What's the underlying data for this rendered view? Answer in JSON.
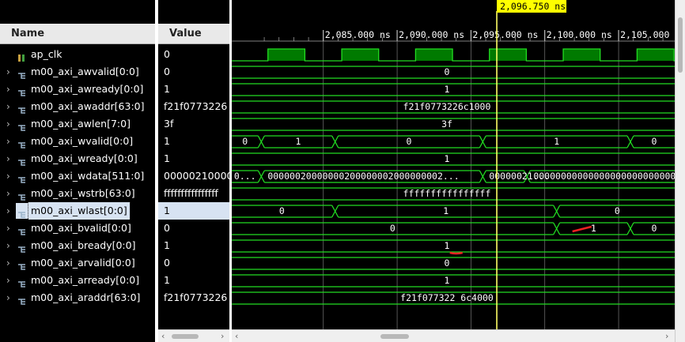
{
  "headers": {
    "name": "Name",
    "value": "Value"
  },
  "signals": [
    {
      "name": "ap_clk",
      "value": "0",
      "expandable": false,
      "icon": "clock-signal-icon"
    },
    {
      "name": "m00_axi_awvalid[0:0]",
      "value": "0",
      "expandable": true
    },
    {
      "name": "m00_axi_awready[0:0]",
      "value": "1",
      "expandable": true
    },
    {
      "name": "m00_axi_awaddr[63:0]",
      "value": "f21f0773226",
      "expandable": true
    },
    {
      "name": "m00_axi_awlen[7:0]",
      "value": "3f",
      "expandable": true
    },
    {
      "name": "m00_axi_wvalid[0:0]",
      "value": "1",
      "expandable": true
    },
    {
      "name": "m00_axi_wready[0:0]",
      "value": "1",
      "expandable": true
    },
    {
      "name": "m00_axi_wdata[511:0]",
      "value": "00000210000",
      "expandable": true
    },
    {
      "name": "m00_axi_wstrb[63:0]",
      "value": "ffffffffffffffff",
      "expandable": true
    },
    {
      "name": "m00_axi_wlast[0:0]",
      "value": "1",
      "expandable": true,
      "selected": true
    },
    {
      "name": "m00_axi_bvalid[0:0]",
      "value": "0",
      "expandable": true
    },
    {
      "name": "m00_axi_bready[0:0]",
      "value": "1",
      "expandable": true
    },
    {
      "name": "m00_axi_arvalid[0:0]",
      "value": "0",
      "expandable": true
    },
    {
      "name": "m00_axi_arready[0:0]",
      "value": "1",
      "expandable": true
    },
    {
      "name": "m00_axi_araddr[63:0]",
      "value": "f21f0773226",
      "expandable": true
    }
  ],
  "timeline": {
    "cursor_label": "2,096.750 ns",
    "cursor_time": 2096.75,
    "ticks": [
      "2,085.000 ns",
      "2,090.000 ns",
      "2,095.000 ns",
      "2,100.000 ns",
      "2,105.000 ns"
    ],
    "tick_times": [
      2085,
      2090,
      2095,
      2100,
      2105
    ],
    "view_start": 2078.8,
    "view_end": 2108.8
  },
  "waves": {
    "clk_high_ranges": [
      [
        2081.25,
        2083.75
      ],
      [
        2086.25,
        2088.75
      ],
      [
        2091.25,
        2093.75
      ],
      [
        2096.25,
        2098.75
      ],
      [
        2101.25,
        2103.75
      ],
      [
        2106.25,
        2108.75
      ]
    ],
    "awvalid": "0",
    "awready": "1",
    "awaddr": "f21f0773226c1000",
    "awlen": "3f",
    "wvalid": [
      {
        "from": 2078.8,
        "to": 2080.8,
        "label": "0"
      },
      {
        "from": 2080.8,
        "to": 2085.8,
        "label": "1"
      },
      {
        "from": 2085.8,
        "to": 2095.8,
        "label": "0"
      },
      {
        "from": 2095.8,
        "to": 2105.8,
        "label": "1"
      },
      {
        "from": 2105.8,
        "to": 2108.8,
        "label": "0"
      }
    ],
    "wready": "1",
    "wdata": [
      {
        "from": 2078.8,
        "to": 2080.8,
        "label": "0..."
      },
      {
        "from": 2080.8,
        "to": 2095.8,
        "label": "00000020000000200000002000000002..."
      },
      {
        "from": 2095.8,
        "to": 2098.8,
        "label": "00000021..."
      },
      {
        "from": 2098.8,
        "to": 2108.8,
        "label": "0000000000000000000000000000000"
      }
    ],
    "wstrb": "ffffffffffffffff",
    "wlast": [
      {
        "from": 2078.8,
        "to": 2085.8,
        "label": "0"
      },
      {
        "from": 2085.8,
        "to": 2100.8,
        "label": "1"
      },
      {
        "from": 2100.8,
        "to": 2108.8,
        "label": "0"
      }
    ],
    "bvalid": [
      {
        "from": 2078.8,
        "to": 2100.8,
        "label": "0"
      },
      {
        "from": 2100.8,
        "to": 2105.8,
        "label": "1"
      },
      {
        "from": 2105.8,
        "to": 2108.8,
        "label": "0"
      }
    ],
    "bready": "1",
    "arvalid": "0",
    "arready": "1",
    "araddr": "f21f077322 6c4000"
  },
  "colors": {
    "wave": "#22dd22",
    "cursor": "#ffff66",
    "text": "#ffffff",
    "annotation": "#ee2222"
  }
}
